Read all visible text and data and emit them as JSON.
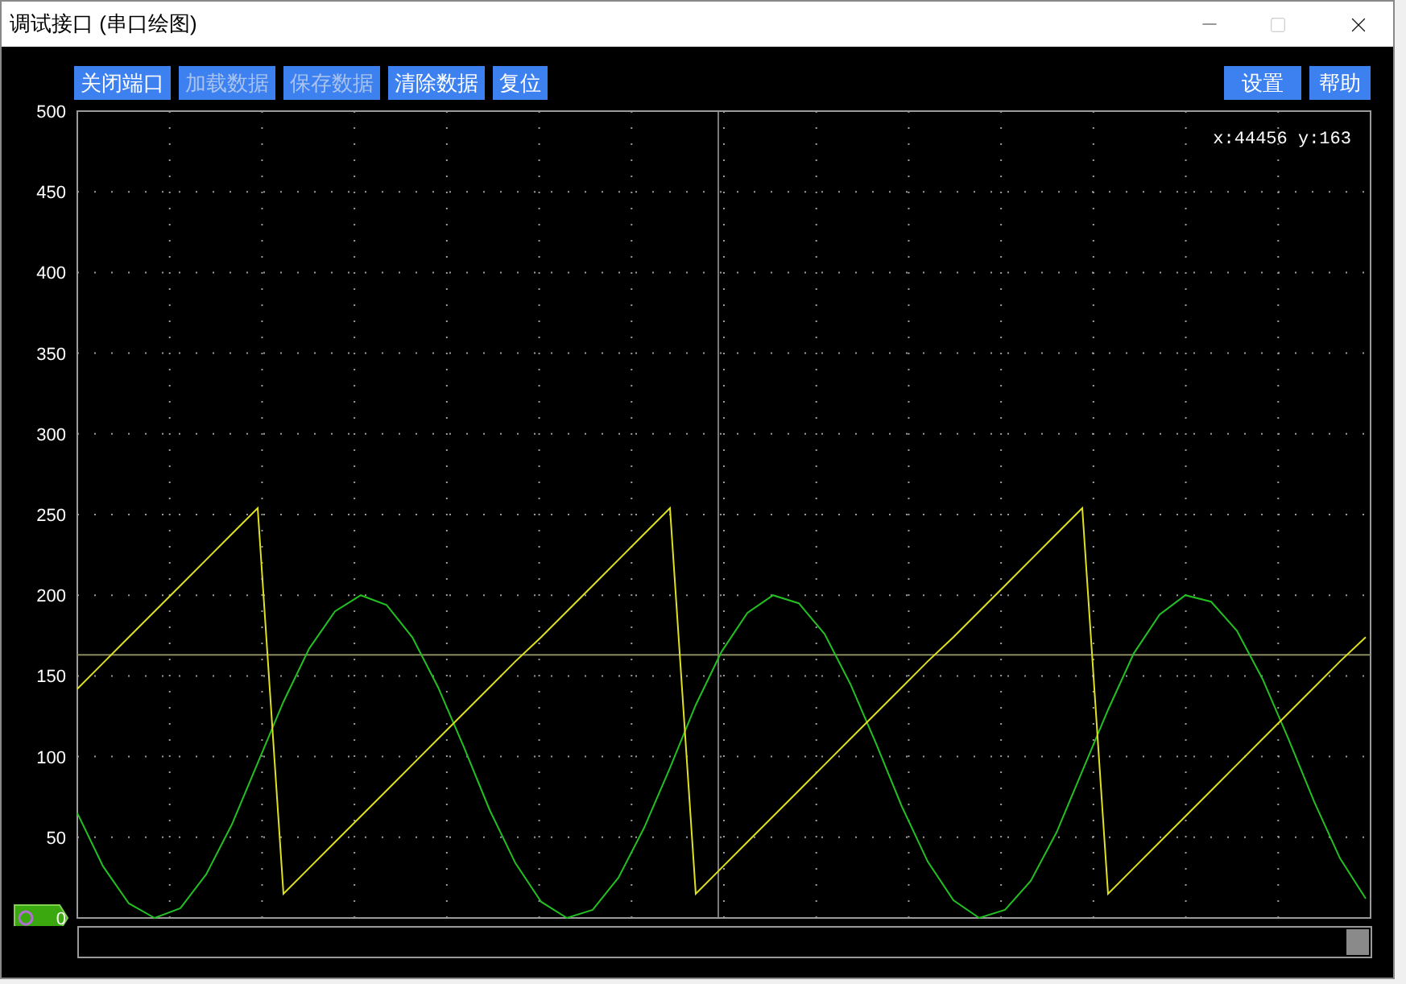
{
  "window": {
    "title": "调试接口 (串口绘图)"
  },
  "toolbar": {
    "left_buttons": [
      {
        "label": "关闭端口",
        "disabled": false
      },
      {
        "label": "加载数据",
        "disabled": true
      },
      {
        "label": "保存数据",
        "disabled": true
      },
      {
        "label": "清除数据",
        "disabled": false
      },
      {
        "label": "复位",
        "disabled": false
      }
    ],
    "right_buttons": [
      {
        "label": "设置",
        "disabled": false
      },
      {
        "label": "帮助",
        "disabled": false
      }
    ]
  },
  "plot": {
    "cursor_readout": "x:44456 y:163",
    "chart_data": {
      "type": "line",
      "ylim": [
        0,
        500
      ],
      "yticks": [
        0,
        50,
        100,
        150,
        200,
        250,
        300,
        350,
        400,
        450,
        500
      ],
      "categories": [
        null,
        null,
        null,
        null,
        null,
        null,
        null,
        null,
        null,
        null,
        null,
        null,
        null,
        null,
        null,
        null,
        null,
        null,
        null,
        null,
        null,
        null,
        null,
        null,
        null,
        null,
        null,
        null,
        null,
        null,
        null,
        null,
        null,
        null,
        null,
        null,
        null,
        null,
        null,
        null,
        null,
        null,
        null,
        null,
        null,
        null,
        null,
        null,
        null,
        null,
        null
      ],
      "series": [
        {
          "color": "#22c022",
          "values": [
            65,
            32,
            9,
            0,
            6,
            27,
            58,
            96,
            134,
            167,
            190,
            200,
            194,
            174,
            143,
            106,
            67,
            34,
            10,
            0,
            5,
            25,
            56,
            93,
            132,
            165,
            189,
            200,
            195,
            176,
            145,
            108,
            69,
            35,
            11,
            0,
            5,
            23,
            53,
            91,
            129,
            164,
            188,
            200,
            196,
            178,
            148,
            111,
            72,
            37,
            12
          ]
        },
        {
          "color": "#e0e020",
          "values": [
            142,
            158,
            174,
            190,
            206,
            222,
            238,
            254,
            15,
            31,
            47,
            63,
            79,
            95,
            111,
            127,
            143,
            159,
            174,
            190,
            206,
            222,
            238,
            254,
            15,
            31,
            47,
            63,
            79,
            95,
            111,
            127,
            143,
            159,
            174,
            190,
            206,
            222,
            238,
            254,
            15,
            31,
            47,
            63,
            79,
            95,
            111,
            127,
            143,
            159,
            174
          ]
        }
      ],
      "grid": true,
      "ref_lines": [
        {
          "axis": "y",
          "value": 163
        }
      ]
    }
  }
}
